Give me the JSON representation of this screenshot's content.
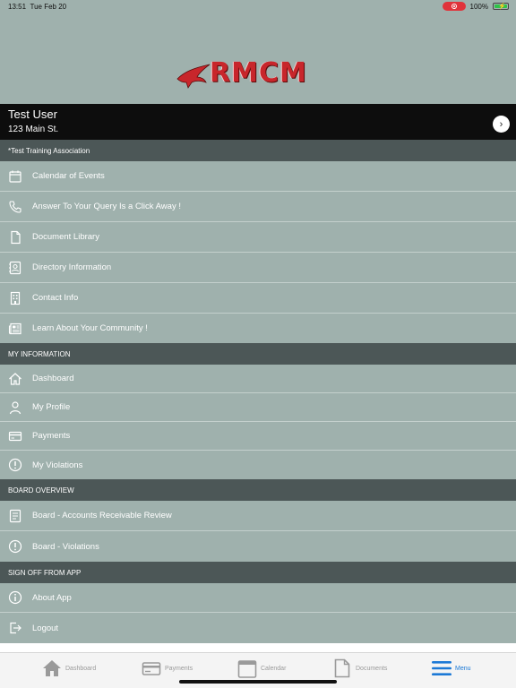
{
  "status": {
    "time": "13:51",
    "date": "Tue Feb 20",
    "battery": "100%"
  },
  "brand": {
    "logo_text": "RMCM"
  },
  "user": {
    "name": "Test User",
    "address": "123 Main St."
  },
  "sections": [
    {
      "title": "*Test Training Association",
      "items": [
        {
          "label": "Calendar of Events",
          "icon": "calendar-icon"
        },
        {
          "label": "Answer To Your Query Is a Click Away !",
          "icon": "phone-icon"
        },
        {
          "label": "Document Library",
          "icon": "document-icon"
        },
        {
          "label": "Directory Information",
          "icon": "contact-card-icon"
        },
        {
          "label": "Contact Info",
          "icon": "building-icon"
        },
        {
          "label": "Learn About Your Community !",
          "icon": "newspaper-icon"
        }
      ]
    },
    {
      "title": "MY INFORMATION",
      "items": [
        {
          "label": "Dashboard",
          "icon": "home-icon"
        },
        {
          "label": "My Profile",
          "icon": "person-icon"
        },
        {
          "label": "Payments",
          "icon": "credit-card-icon"
        },
        {
          "label": "My Violations",
          "icon": "alert-circle-icon"
        }
      ]
    },
    {
      "title": "BOARD OVERVIEW",
      "items": [
        {
          "label": "Board - Accounts Receivable Review",
          "icon": "ledger-icon"
        },
        {
          "label": "Board - Violations",
          "icon": "alert-circle-icon"
        }
      ]
    },
    {
      "title": "SIGN OFF FROM APP",
      "items": [
        {
          "label": "About App",
          "icon": "info-icon"
        },
        {
          "label": "Logout",
          "icon": "logout-icon"
        }
      ]
    }
  ],
  "tabs": [
    {
      "label": "Dashboard",
      "icon": "home-icon"
    },
    {
      "label": "Payments",
      "icon": "credit-card-icon"
    },
    {
      "label": "Calendar",
      "icon": "calendar-icon"
    },
    {
      "label": "Documents",
      "icon": "document-icon"
    },
    {
      "label": "Menu",
      "icon": "menu-icon",
      "active": true
    }
  ],
  "colors": {
    "background": "#9fb1ad",
    "section_header": "#4c5757",
    "accent": "#1c79d6",
    "logo_red": "#c8262b"
  }
}
